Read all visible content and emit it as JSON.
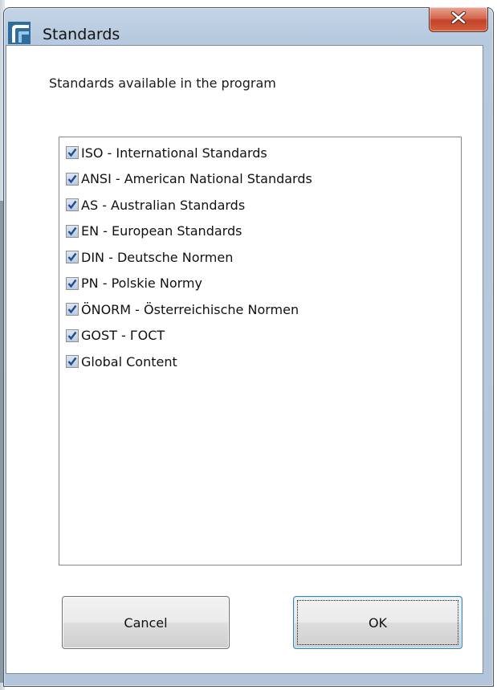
{
  "window": {
    "title": "Standards"
  },
  "dialog": {
    "description": "Standards available in the program"
  },
  "standards": [
    {
      "label": "ISO - International Standards",
      "checked": true
    },
    {
      "label": "ANSI - American National Standards",
      "checked": true
    },
    {
      "label": "AS - Australian Standards",
      "checked": true
    },
    {
      "label": "EN - European Standards",
      "checked": true
    },
    {
      "label": "DIN - Deutsche Normen",
      "checked": true
    },
    {
      "label": "PN - Polskie Normy",
      "checked": true
    },
    {
      "label": "ÖNORM - Österreichische Normen",
      "checked": true
    },
    {
      "label": "GOST - ГОСТ",
      "checked": true
    },
    {
      "label": "Global Content",
      "checked": true
    }
  ],
  "buttons": {
    "cancel": "Cancel",
    "ok": "OK"
  },
  "colors": {
    "titlebar": "#b7c9de",
    "close_button": "#c2412a",
    "checkmark": "#1f4c8a",
    "focus_border": "#3c7fb1"
  },
  "icons": {
    "app": "app-logo-icon",
    "close": "close-icon",
    "check": "checkmark-icon"
  }
}
